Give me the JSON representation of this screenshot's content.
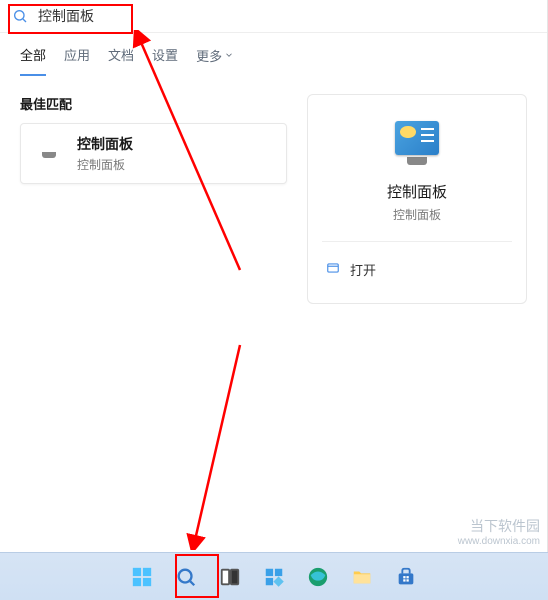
{
  "search": {
    "query": "控制面板"
  },
  "tabs": {
    "all": "全部",
    "apps": "应用",
    "docs": "文档",
    "settings": "设置",
    "more": "更多"
  },
  "best_match_label": "最佳匹配",
  "result": {
    "title": "控制面板",
    "subtitle": "控制面板"
  },
  "detail": {
    "title": "控制面板",
    "subtitle": "控制面板",
    "open_label": "打开"
  },
  "watermark": {
    "line1": "当下软件园",
    "line2": "www.downxia.com"
  }
}
